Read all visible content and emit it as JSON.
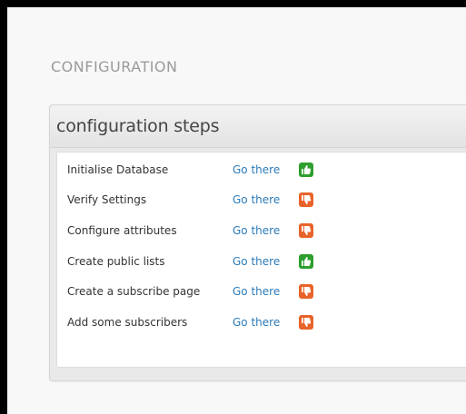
{
  "page": {
    "heading": "CONFIGURATION"
  },
  "panel": {
    "title": "configuration steps"
  },
  "steps": [
    {
      "label": "Initialise Database",
      "link": "Go there",
      "status": "done",
      "icon": "thumbs-up-icon",
      "color": "#2e9e2e"
    },
    {
      "label": "Verify Settings",
      "link": "Go there",
      "status": "todo",
      "icon": "thumbs-down-icon",
      "color": "#e8632a"
    },
    {
      "label": "Configure attributes",
      "link": "Go there",
      "status": "todo",
      "icon": "thumbs-down-icon",
      "color": "#e8632a"
    },
    {
      "label": "Create public lists",
      "link": "Go there",
      "status": "done",
      "icon": "thumbs-up-icon",
      "color": "#2e9e2e"
    },
    {
      "label": "Create a subscribe page",
      "link": "Go there",
      "status": "todo",
      "icon": "thumbs-down-icon",
      "color": "#e8632a"
    },
    {
      "label": "Add some subscribers",
      "link": "Go there",
      "status": "todo",
      "icon": "thumbs-down-icon",
      "color": "#e8632a"
    }
  ],
  "colors": {
    "link": "#2b7bb9",
    "ok": "#2e9e2e",
    "todo": "#e8632a"
  }
}
